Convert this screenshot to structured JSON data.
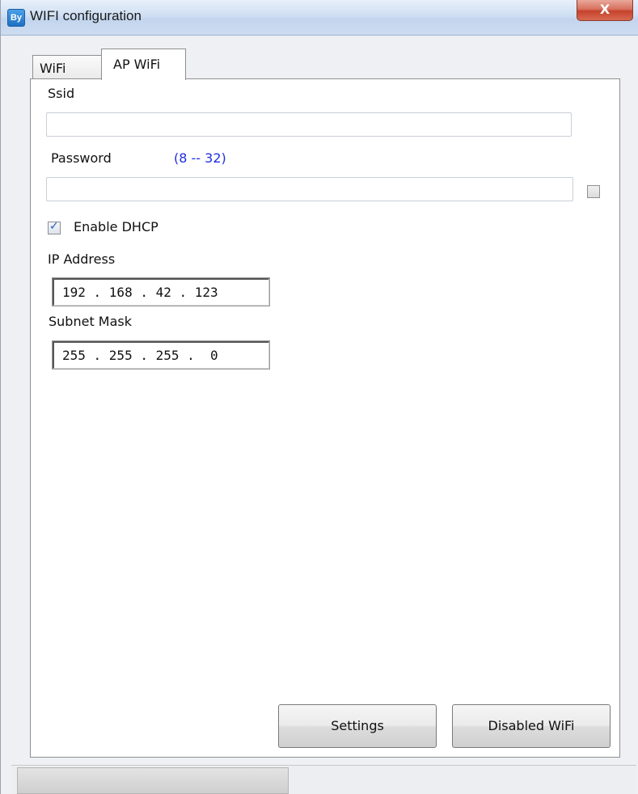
{
  "window": {
    "title": "WIFI configuration",
    "icon_text": "By",
    "close_label": "X"
  },
  "tabs": [
    {
      "label": "WiFi",
      "active": false
    },
    {
      "label": "AP WiFi",
      "active": true
    }
  ],
  "form": {
    "ssid_label": "Ssid",
    "ssid_value": "",
    "password_label": "Password",
    "password_hint": "(8 -- 32)",
    "password_value": "",
    "show_password_checked": false,
    "dhcp_label": "Enable DHCP",
    "dhcp_checked": true,
    "ip_label": "IP Address",
    "ip_value": "192 . 168 . 42 . 123",
    "subnet_label": "Subnet Mask",
    "subnet_value": "255 . 255 . 255 .  0"
  },
  "buttons": {
    "settings": "Settings",
    "disable_wifi": "Disabled WiFi"
  },
  "colors": {
    "hint": "#1f2ee0",
    "checkmark": "#2b59b5"
  }
}
